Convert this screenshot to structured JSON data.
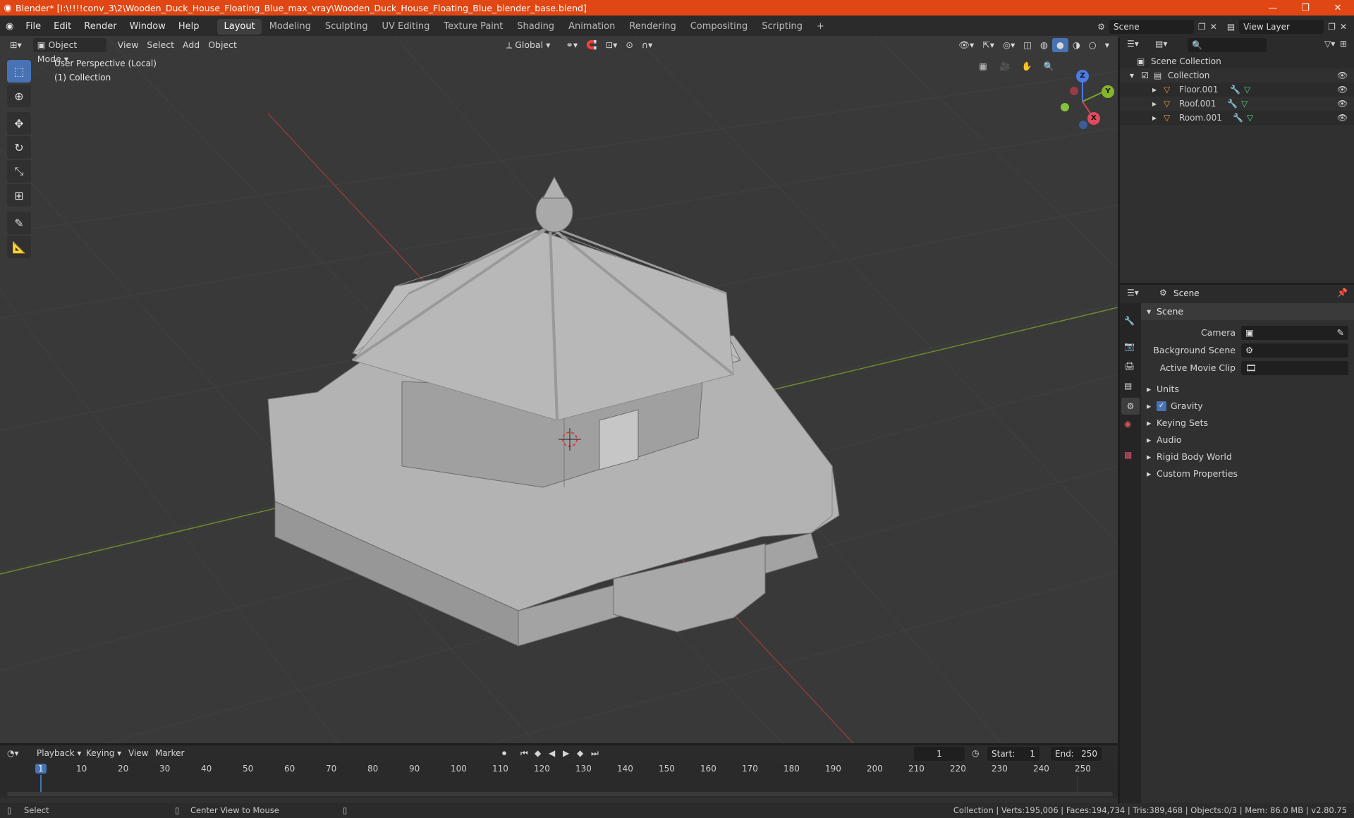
{
  "window": {
    "title": "Blender* [I:\\!!!!conv_3\\2\\Wooden_Duck_House_Floating_Blue_max_vray\\Wooden_Duck_House_Floating_Blue_blender_base.blend]"
  },
  "menu": [
    "File",
    "Edit",
    "Render",
    "Window",
    "Help"
  ],
  "workspaces": [
    "Layout",
    "Modeling",
    "Sculpting",
    "UV Editing",
    "Texture Paint",
    "Shading",
    "Animation",
    "Rendering",
    "Compositing",
    "Scripting"
  ],
  "active_workspace": "Layout",
  "scene_field": "Scene",
  "view_layer_field": "View Layer",
  "viewport_header": {
    "mode": "Object Mode",
    "view": "View",
    "select": "Select",
    "add": "Add",
    "object": "Object",
    "orientation": "Global"
  },
  "viewport": {
    "perspective": "User Perspective (Local)",
    "collection": "(1) Collection"
  },
  "gizmo": {
    "x": "X",
    "y": "Y",
    "z": "Z"
  },
  "outliner": {
    "root": "Scene Collection",
    "collection": "Collection",
    "objects": [
      "Floor.001",
      "Roof.001",
      "Room.001"
    ]
  },
  "properties": {
    "header": "Scene",
    "panel": "Scene",
    "camera_label": "Camera",
    "background_scene_label": "Background Scene",
    "active_movie_clip_label": "Active Movie Clip",
    "sections": [
      "Units",
      "Gravity",
      "Keying Sets",
      "Audio",
      "Rigid Body World",
      "Custom Properties"
    ]
  },
  "timeline": {
    "menus": [
      "Playback",
      "Keying",
      "View",
      "Marker"
    ],
    "current_frame": "1",
    "start_label": "Start:",
    "start": "1",
    "end_label": "End:",
    "end": "250",
    "ticks": [
      "1",
      "10",
      "20",
      "30",
      "40",
      "50",
      "60",
      "70",
      "80",
      "90",
      "100",
      "110",
      "120",
      "130",
      "140",
      "150",
      "160",
      "170",
      "180",
      "190",
      "200",
      "210",
      "220",
      "230",
      "240",
      "250"
    ]
  },
  "status": {
    "select": "Select",
    "center": "Center View to Mouse",
    "stats": "Collection | Verts:195,006 | Faces:194,734 | Tris:389,468 | Objects:0/3 | Mem: 86.0 MB | v2.80.75"
  }
}
